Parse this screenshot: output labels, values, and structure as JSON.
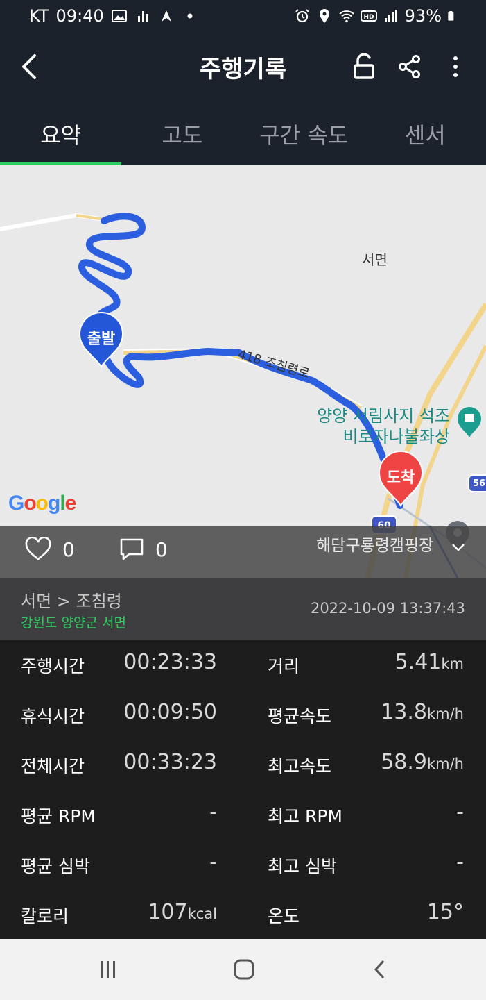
{
  "status_bar": {
    "carrier": "KT",
    "time": "09:40",
    "battery": "93%",
    "left_icons": [
      "gallery-icon",
      "signal-bars-icon",
      "app-icon",
      "dot-icon"
    ],
    "right_icons": [
      "alarm-icon",
      "location-icon",
      "wifi-icon",
      "hd-icon",
      "cell-signal-icon",
      "battery-icon"
    ]
  },
  "appbar": {
    "title": "주행기록",
    "icons": [
      "back-icon",
      "unlock-icon",
      "share-icon",
      "more-icon"
    ]
  },
  "tabs": [
    {
      "label": "요약",
      "active": true
    },
    {
      "label": "고도",
      "active": false
    },
    {
      "label": "구간 속도",
      "active": false
    },
    {
      "label": "센서",
      "active": false
    }
  ],
  "map": {
    "area_label": "서면",
    "road_label": "418  조침령로",
    "start_marker": "출발",
    "end_marker": "도착",
    "poi_name_line1": "양양 서림사지 석조",
    "poi_name_line2": "비로자나불좌상",
    "campsite": "해담구룡령캠핑장",
    "route_badge_60": "60",
    "route_badge_56": "56",
    "route_color": "#2b5fe0",
    "start_marker_color": "#2357d8",
    "end_marker_color": "#ef4444",
    "logo": "Google"
  },
  "social": {
    "likes": "0",
    "comments": "0"
  },
  "location": {
    "route": "서면 > 조침령",
    "region": "강원도 양양군 서면",
    "datetime": "2022-10-09 13:37:43"
  },
  "stats": {
    "ride_time": {
      "label": "주행시간",
      "value": "00:23:33"
    },
    "distance": {
      "label": "거리",
      "value": "5.41",
      "unit": "km"
    },
    "rest_time": {
      "label": "휴식시간",
      "value": "00:09:50"
    },
    "avg_speed": {
      "label": "평균속도",
      "value": "13.8",
      "unit": "km/h"
    },
    "total_time": {
      "label": "전체시간",
      "value": "00:33:23"
    },
    "max_speed": {
      "label": "최고속도",
      "value": "58.9",
      "unit": "km/h"
    },
    "avg_rpm": {
      "label": "평균 RPM",
      "value": "-"
    },
    "max_rpm": {
      "label": "최고 RPM",
      "value": "-"
    },
    "avg_hr": {
      "label": "평균 심박",
      "value": "-"
    },
    "max_hr": {
      "label": "최고 심박",
      "value": "-"
    },
    "calories": {
      "label": "칼로리",
      "value": "107",
      "unit": "kcal"
    },
    "temperature": {
      "label": "온도",
      "value": "15°"
    }
  },
  "accent_color": "#2ecc5f",
  "navbar": {
    "icons": [
      "recents-icon",
      "home-icon",
      "back-nav-icon"
    ]
  }
}
